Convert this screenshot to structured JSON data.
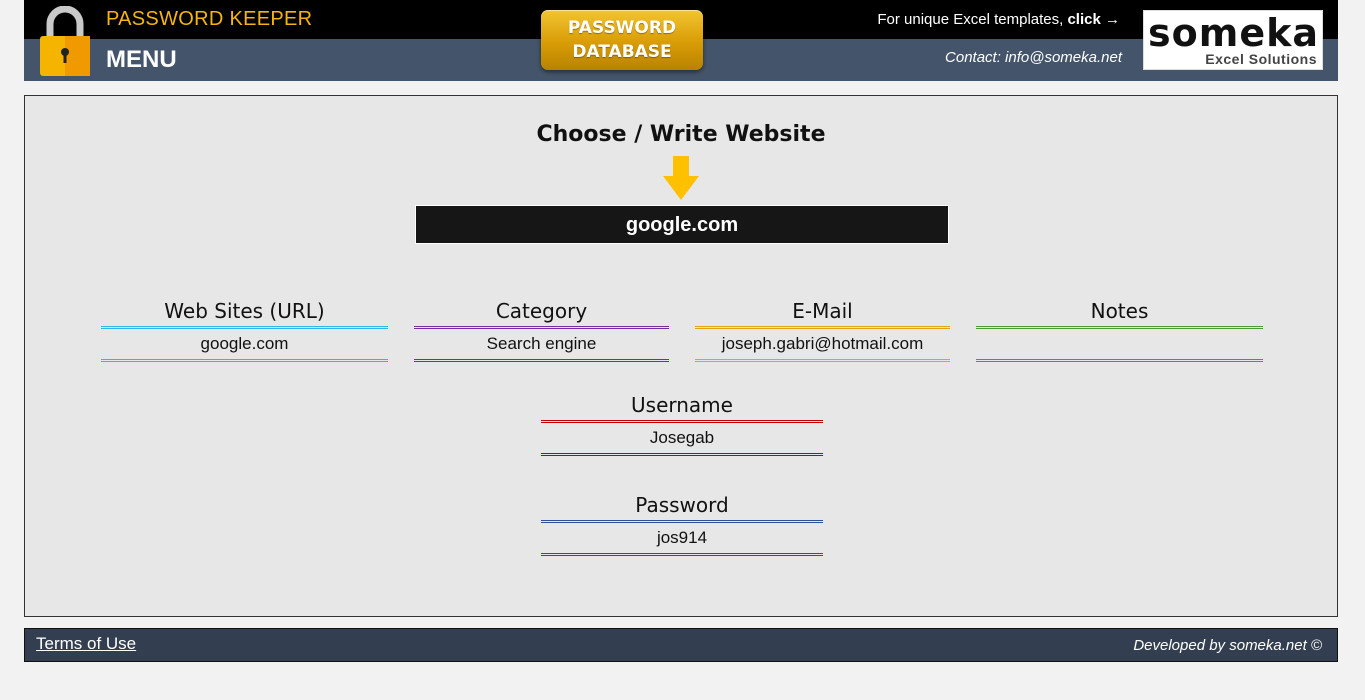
{
  "header": {
    "app_title": "PASSWORD KEEPER",
    "menu_label": "MENU",
    "db_button_label": "PASSWORD\nDATABASE",
    "promo_text": "For unique Excel templates, ",
    "promo_click": "click →",
    "contact": "Contact: info@someka.net",
    "logo_word": "someka",
    "logo_sub": "Excel Solutions"
  },
  "main": {
    "choose_title": "Choose / Write Website",
    "selected_site": "google.com",
    "fields": {
      "website": {
        "label": "Web Sites (URL)",
        "value": "google.com",
        "color": "#2eb7e8"
      },
      "category": {
        "label": "Category",
        "value": "Search engine",
        "color": "#7030a0"
      },
      "email": {
        "label": "E-Mail",
        "value": "joseph.gabri@hotmail.com",
        "color": "#e0a416"
      },
      "notes": {
        "label": "Notes",
        "value": "",
        "color": "#4c9a3a"
      },
      "username": {
        "label": "Username",
        "value": "Josegab",
        "color": "#c00000"
      },
      "password": {
        "label": "Password",
        "value": "jos914",
        "color": "#2f4f9a"
      }
    }
  },
  "footer": {
    "terms": "Terms of Use",
    "developed": "Developed by someka.net ©"
  },
  "colors": {
    "accent_gold": "#f6b50e",
    "header_dark": "#000000",
    "header_slate": "#44546a",
    "footer_bg": "#333f50"
  }
}
